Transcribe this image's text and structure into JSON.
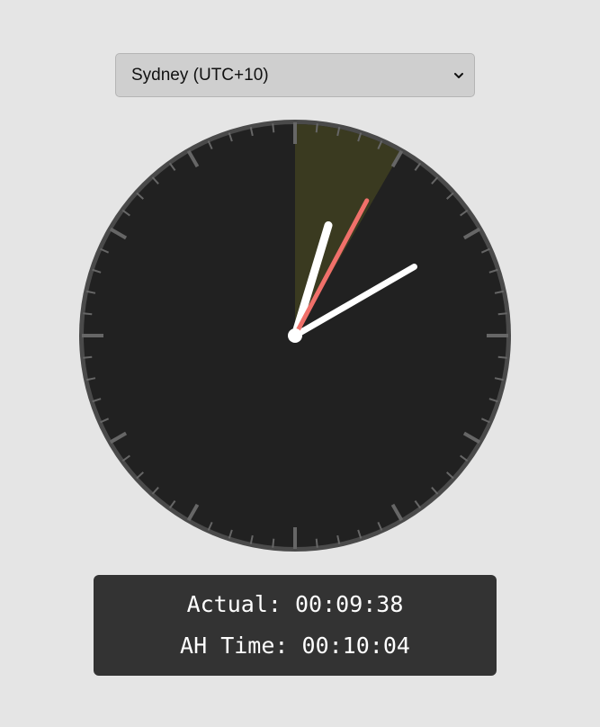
{
  "timezone_select": {
    "selected": "Sydney (UTC+10)"
  },
  "clock": {
    "actual_time": "00:09:38",
    "ah_time": "00:10:04",
    "highlight_fraction": 0.0833,
    "colors": {
      "face": "#212121",
      "rim": "#4a4a4a",
      "ticks": "#666666",
      "hands": "#ffffff",
      "second_hand": "#f0706a",
      "highlight": "#3a3a20"
    }
  },
  "readout": {
    "actual_label": "Actual:",
    "ah_label": "AH Time:"
  },
  "icons": {
    "dropdown": "chevron-down-icon"
  }
}
